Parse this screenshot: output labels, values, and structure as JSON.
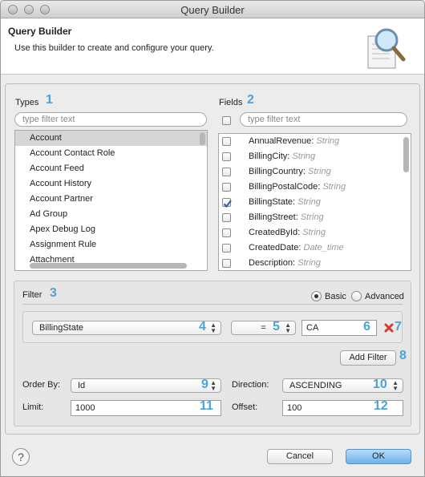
{
  "window": {
    "title": "Query Builder"
  },
  "header": {
    "title": "Query Builder",
    "description": "Use this builder to create and configure your query."
  },
  "types": {
    "label": "Types",
    "number": "1",
    "filter_placeholder": "type filter text",
    "items": [
      "Account",
      "Account Contact Role",
      "Account Feed",
      "Account History",
      "Account Partner",
      "Ad Group",
      "Apex Debug Log",
      "Assignment Rule",
      "Attachment"
    ],
    "selected_index": 0
  },
  "fields": {
    "label": "Fields",
    "number": "2",
    "filter_placeholder": "type filter text",
    "items": [
      {
        "name": "AnnualRevenue:",
        "type": "String",
        "checked": false
      },
      {
        "name": "BillingCity:",
        "type": "String",
        "checked": false
      },
      {
        "name": "BillingCountry:",
        "type": "String",
        "checked": false
      },
      {
        "name": "BillingPostalCode:",
        "type": "String",
        "checked": false
      },
      {
        "name": "BillingState:",
        "type": "String",
        "checked": true
      },
      {
        "name": "BillingStreet:",
        "type": "String",
        "checked": false
      },
      {
        "name": "CreatedById:",
        "type": "String",
        "checked": false
      },
      {
        "name": "CreatedDate:",
        "type": "Date_time",
        "checked": false
      },
      {
        "name": "Description:",
        "type": "String",
        "checked": false
      }
    ]
  },
  "filter": {
    "label": "Filter",
    "number": "3",
    "mode_basic": "Basic",
    "mode_advanced": "Advanced",
    "selected_mode": "Basic",
    "field_select": "BillingState",
    "field_number": "4",
    "operator_select": "=",
    "operator_number": "5",
    "value": "CA",
    "value_number": "6",
    "remove_number": "7",
    "add_filter": "Add Filter",
    "add_number": "8"
  },
  "order": {
    "order_by_label": "Order By:",
    "order_by_value": "Id",
    "order_by_number": "9",
    "direction_label": "Direction:",
    "direction_value": "ASCENDING",
    "direction_number": "10",
    "limit_label": "Limit:",
    "limit_value": "1000",
    "limit_number": "11",
    "offset_label": "Offset:",
    "offset_value": "100",
    "offset_number": "12"
  },
  "buttons": {
    "help": "?",
    "cancel": "Cancel",
    "ok": "OK"
  },
  "colors": {
    "accent_number": "#4ea2d6",
    "ok_button": "#8ec5f2",
    "remove_icon": "#d63a2c"
  }
}
